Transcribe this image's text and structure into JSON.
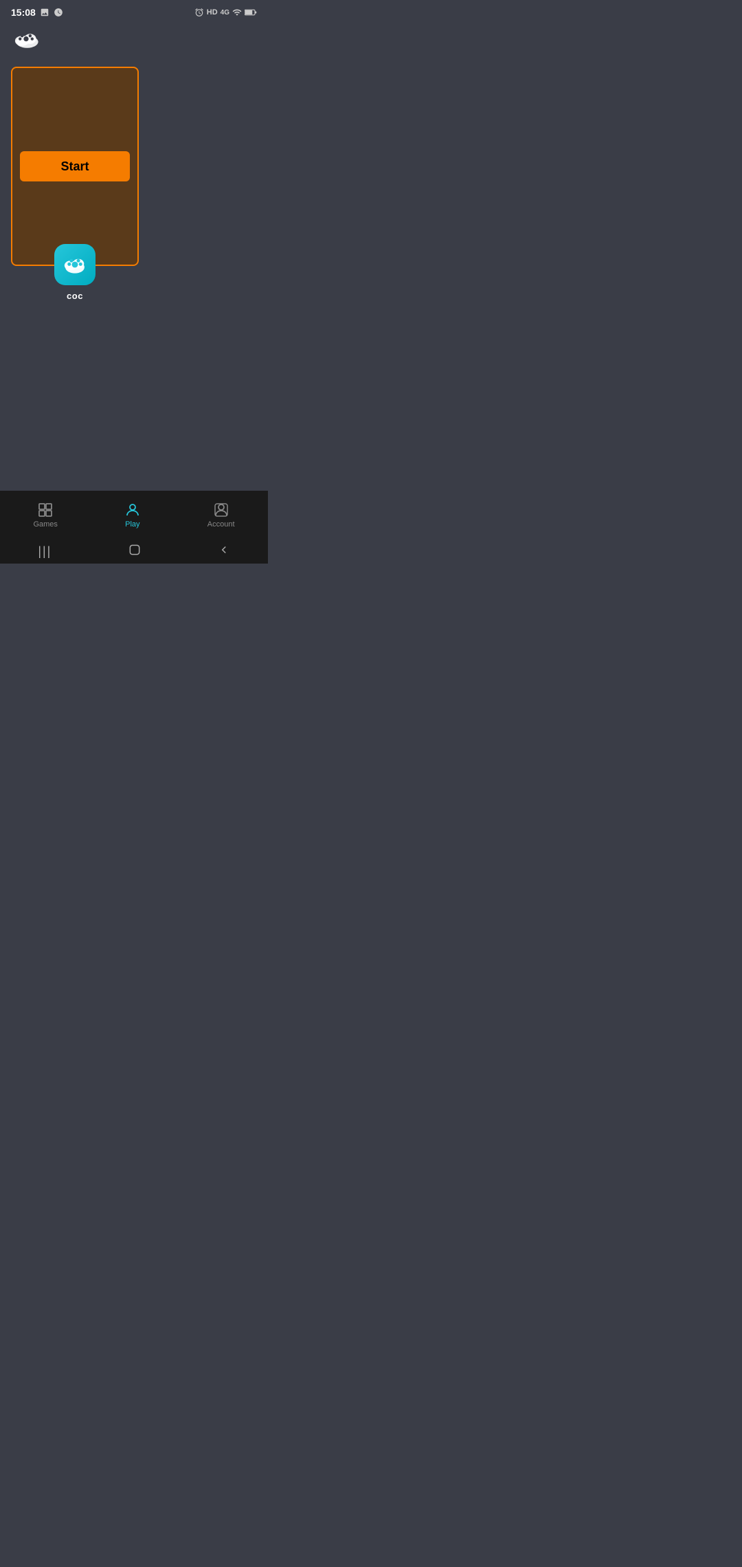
{
  "status_bar": {
    "time": "15:08",
    "left_icons": [
      "photo-icon",
      "clock-icon"
    ],
    "right_icons": [
      "alarm-icon",
      "hd-label",
      "4g-label",
      "signal-icon",
      "battery-icon"
    ],
    "hd_label": "HD",
    "4g_label": "4G"
  },
  "header": {
    "icon_alt": "paw cloud icon"
  },
  "game_card": {
    "start_button_label": "Start",
    "game_icon_alt": "coc app icon",
    "game_name": "coc"
  },
  "bottom_nav": {
    "items": [
      {
        "id": "games",
        "label": "Games",
        "active": false
      },
      {
        "id": "play",
        "label": "Play",
        "active": true
      },
      {
        "id": "account",
        "label": "Account",
        "active": false
      }
    ]
  },
  "system_nav": {
    "buttons": [
      "recent-apps",
      "home",
      "back"
    ]
  }
}
